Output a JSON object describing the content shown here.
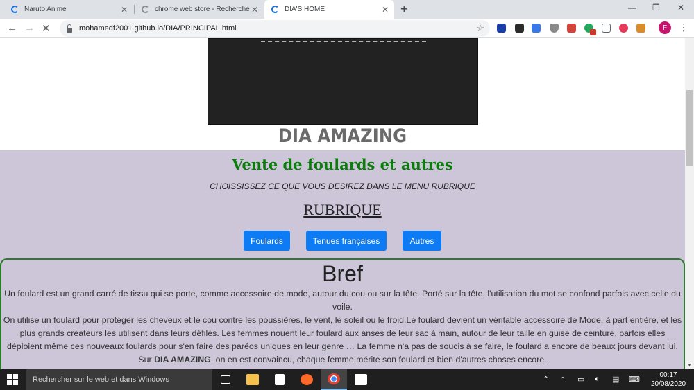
{
  "browser": {
    "tabs": [
      {
        "title": "Naruto Anime",
        "active": false
      },
      {
        "title": "chrome web store - Recherche G",
        "active": false
      },
      {
        "title": "DIA'S HOME",
        "active": true
      }
    ],
    "url": "mohamedf2001.github.io/DIA/PRINCIPAL.html",
    "profile_initial": "F",
    "extension_badge": "1"
  },
  "page": {
    "brand": "DIA AMAZING",
    "tagline": "Vente de foulards et autres",
    "instruction": "CHOISSISSEZ CE QUE VOUS DESIREZ DANS LE MENU RUBRIQUE",
    "menu_title": "RUBRIQUE",
    "buttons": [
      "Foulards",
      "Tenues françaises",
      "Autres"
    ],
    "bref": {
      "title": "Bref",
      "p1": "Un foulard est un grand carré de tissu qui se porte, comme accessoire de mode, autour du cou ou sur la tête. Porté sur la tête, l'utilisation du mot se confond parfois avec celle du voile.",
      "p2_part1": "On utilise un foulard pour protéger les cheveux et le cou contre les poussières, le vent, le soleil ou le froid.Le foulard devient un véritable accessoire de Mode, à part entière, et les plus grands créateurs les utilisent dans leurs défilés. Les femmes nouent leur foulard aux anses de leur sac à main, autour de leur taille en guise de ceinture, parfois elles déploient même ces nouveaux foulards pour s'en faire des paréos uniques en leur genre … La femme n'a pas de soucis à se faire, le foulard a encore de beaux jours devant lui. Sur ",
      "p2_bold": "DIA AMAZING",
      "p2_part2": ", on en est convaincu, chaque femme mérite son foulard et bien d'autres choses encore."
    }
  },
  "taskbar": {
    "search_placeholder": "Rechercher sur le web et dans Windows",
    "time": "00:17",
    "date": "20/08/2020"
  },
  "colors": {
    "accent_button": "#0d7bf4",
    "tagline_green": "#0a7d0a",
    "section_bg": "#ccc6d8"
  }
}
